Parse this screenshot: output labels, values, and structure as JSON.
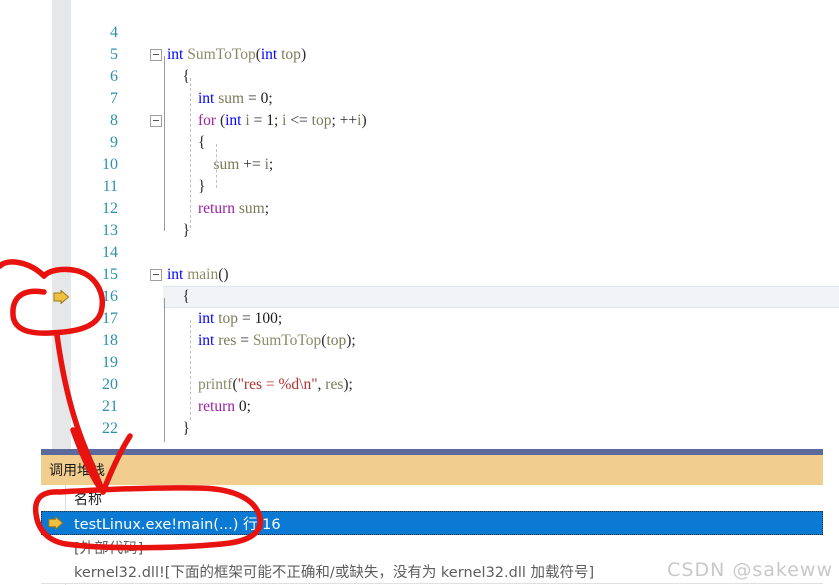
{
  "editor": {
    "first_visible_line": 4,
    "current_line": 16,
    "lines": [
      {
        "num": 4,
        "text": "",
        "tokens": []
      },
      {
        "num": 5,
        "fold": true,
        "indent": 0,
        "tokens": [
          {
            "t": "int",
            "c": "kw-blue"
          },
          {
            "t": " ",
            "c": "plain"
          },
          {
            "t": "SumToTop",
            "c": "fn"
          },
          {
            "t": "(",
            "c": "plain"
          },
          {
            "t": "int",
            "c": "kw-blue"
          },
          {
            "t": " ",
            "c": "plain"
          },
          {
            "t": "top",
            "c": "ident"
          },
          {
            "t": ")",
            "c": "plain"
          }
        ]
      },
      {
        "num": 6,
        "tokens": [
          {
            "t": "{",
            "c": "plain"
          }
        ],
        "pad": 1
      },
      {
        "num": 7,
        "tokens": [
          {
            "t": "int",
            "c": "kw-blue"
          },
          {
            "t": " ",
            "c": "plain"
          },
          {
            "t": "sum",
            "c": "ident"
          },
          {
            "t": " = ",
            "c": "plain"
          },
          {
            "t": "0",
            "c": "num"
          },
          {
            "t": ";",
            "c": "plain"
          }
        ],
        "pad": 2
      },
      {
        "num": 8,
        "fold": true,
        "tokens": [
          {
            "t": "for",
            "c": "kw-purple"
          },
          {
            "t": " (",
            "c": "plain"
          },
          {
            "t": "int",
            "c": "kw-blue"
          },
          {
            "t": " ",
            "c": "plain"
          },
          {
            "t": "i",
            "c": "ident"
          },
          {
            "t": " = ",
            "c": "plain"
          },
          {
            "t": "1",
            "c": "num"
          },
          {
            "t": "; ",
            "c": "plain"
          },
          {
            "t": "i",
            "c": "ident"
          },
          {
            "t": " <= ",
            "c": "plain"
          },
          {
            "t": "top",
            "c": "ident"
          },
          {
            "t": "; ++",
            "c": "plain"
          },
          {
            "t": "i",
            "c": "ident"
          },
          {
            "t": ")",
            "c": "plain"
          }
        ],
        "pad": 2
      },
      {
        "num": 9,
        "tokens": [
          {
            "t": "{",
            "c": "plain"
          }
        ],
        "pad": 2
      },
      {
        "num": 10,
        "tokens": [
          {
            "t": "sum",
            "c": "ident"
          },
          {
            "t": " += ",
            "c": "plain"
          },
          {
            "t": "i",
            "c": "ident"
          },
          {
            "t": ";",
            "c": "plain"
          }
        ],
        "pad": 3
      },
      {
        "num": 11,
        "tokens": [
          {
            "t": "}",
            "c": "plain"
          }
        ],
        "pad": 2
      },
      {
        "num": 12,
        "tokens": [
          {
            "t": "return",
            "c": "kw-purple"
          },
          {
            "t": " ",
            "c": "plain"
          },
          {
            "t": "sum",
            "c": "ident"
          },
          {
            "t": ";",
            "c": "plain"
          }
        ],
        "pad": 2
      },
      {
        "num": 13,
        "tokens": [
          {
            "t": "}",
            "c": "plain"
          }
        ],
        "pad": 1
      },
      {
        "num": 14,
        "tokens": []
      },
      {
        "num": 15,
        "fold": true,
        "tokens": [
          {
            "t": "int",
            "c": "kw-blue"
          },
          {
            "t": " ",
            "c": "plain"
          },
          {
            "t": "main",
            "c": "fn"
          },
          {
            "t": "()",
            "c": "plain"
          }
        ]
      },
      {
        "num": 16,
        "tokens": [
          {
            "t": "{",
            "c": "plain"
          }
        ],
        "pad": 1,
        "current": true,
        "marker": "yellow-arrow"
      },
      {
        "num": 17,
        "tokens": [
          {
            "t": "int",
            "c": "kw-blue"
          },
          {
            "t": " ",
            "c": "plain"
          },
          {
            "t": "top",
            "c": "ident"
          },
          {
            "t": " = ",
            "c": "plain"
          },
          {
            "t": "100",
            "c": "num"
          },
          {
            "t": ";",
            "c": "plain"
          }
        ],
        "pad": 2
      },
      {
        "num": 18,
        "tokens": [
          {
            "t": "int",
            "c": "kw-blue"
          },
          {
            "t": " ",
            "c": "plain"
          },
          {
            "t": "res",
            "c": "ident"
          },
          {
            "t": " = ",
            "c": "plain"
          },
          {
            "t": "SumToTop",
            "c": "fn"
          },
          {
            "t": "(",
            "c": "plain"
          },
          {
            "t": "top",
            "c": "ident"
          },
          {
            "t": ");",
            "c": "plain"
          }
        ],
        "pad": 2
      },
      {
        "num": 19,
        "tokens": []
      },
      {
        "num": 20,
        "tokens": [
          {
            "t": "printf",
            "c": "fn"
          },
          {
            "t": "(",
            "c": "plain"
          },
          {
            "t": "\"res = %d\\n\"",
            "c": "str"
          },
          {
            "t": ", ",
            "c": "plain"
          },
          {
            "t": "res",
            "c": "ident"
          },
          {
            "t": ");",
            "c": "plain"
          }
        ],
        "pad": 2
      },
      {
        "num": 21,
        "tokens": [
          {
            "t": "return",
            "c": "kw-purple"
          },
          {
            "t": " ",
            "c": "plain"
          },
          {
            "t": "0",
            "c": "num"
          },
          {
            "t": ";",
            "c": "plain"
          }
        ],
        "pad": 2
      },
      {
        "num": 22,
        "tokens": [
          {
            "t": "}",
            "c": "plain"
          }
        ],
        "pad": 1
      }
    ]
  },
  "call_stack": {
    "title": "调用堆栈",
    "column_header": "名称",
    "rows": [
      {
        "text": "testLinux.exe!main(...) 行 16",
        "selected": true,
        "icon": "yellow-arrow"
      },
      {
        "text": "[外部代码]",
        "selected": false,
        "icon": ""
      },
      {
        "text": "kernel32.dll![下面的框架可能不正确和/或缺失，没有为 kernel32.dll 加载符号]",
        "selected": false,
        "icon": ""
      }
    ]
  },
  "watermark": {
    "text": "CSDN @sakeww"
  },
  "annotations": {
    "color": "#e8120e",
    "shapes": [
      {
        "name": "gutter-marker-ellipse",
        "desc": "red hand-drawn ellipse around the yellow current-statement arrow in the editor gutter at line 16"
      },
      {
        "name": "pointer-arrow",
        "desc": "red hand-drawn arrow from gutter marker down to the selected call stack row"
      },
      {
        "name": "call-stack-row-ellipse",
        "desc": "red hand-drawn ellipse around the testLinux.exe!main(...) 行 16 call stack row"
      }
    ]
  },
  "colors": {
    "gutter": "#e6e7e8",
    "line_number": "#2b91af",
    "keyword_blue": "#0000ff",
    "keyword_purple": "#9b1fa0",
    "string": "#b03030",
    "panel_title_bg": "#f2ce8e",
    "panel_topbar": "#5b6a9a",
    "selection_blue": "#0a7ad4",
    "annotation_red": "#e8120e"
  }
}
